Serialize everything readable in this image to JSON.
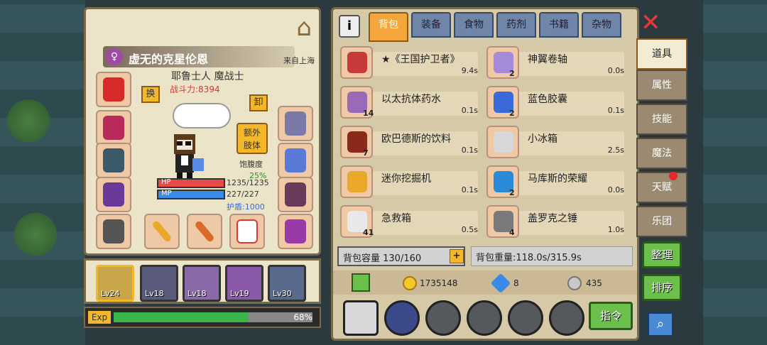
{
  "character": {
    "name": "虚无的克星伦恩",
    "origin": "来自上海",
    "class": "耶鲁士人 魔战士",
    "power": "战斗力:8394",
    "swap_label": "换",
    "unequip_label": "卸",
    "extra_limb_label": "额外\n肢体",
    "hunger_label": "饱腹度",
    "hunger_value": "25%",
    "hp_label": "HP",
    "hp_value": "1235/1235",
    "mp_label": "MP",
    "mp_value": "227/227",
    "shield_label": "护盾:1000"
  },
  "party": [
    {
      "level": "Lv24",
      "active": true
    },
    {
      "level": "Lv18",
      "active": false
    },
    {
      "level": "Lv18",
      "active": false
    },
    {
      "level": "Lv19",
      "active": false
    },
    {
      "level": "Lv30",
      "active": false
    }
  ],
  "exp": {
    "label": "Exp",
    "value": "68%",
    "progress": 0.68
  },
  "tabs": [
    "背包",
    "装备",
    "食物",
    "药剂",
    "书籍",
    "杂物"
  ],
  "active_tab": "背包",
  "items": [
    {
      "name": "★《王国护卫者》",
      "weight": "9.4s",
      "count": "",
      "color": "#c83a3a"
    },
    {
      "name": "神翼卷轴",
      "weight": "0.0s",
      "count": "2",
      "color": "#a48ad8"
    },
    {
      "name": "以太抗体药水",
      "weight": "0.1s",
      "count": "14",
      "color": "#9a6ab8"
    },
    {
      "name": "蓝色胶囊",
      "weight": "0.1s",
      "count": "2",
      "color": "#3a6ad8"
    },
    {
      "name": "欧巴德斯的饮料",
      "weight": "0.1s",
      "count": "7",
      "color": "#8a2a1a"
    },
    {
      "name": "小冰箱",
      "weight": "2.5s",
      "count": "",
      "color": "#d8d8d8"
    },
    {
      "name": "迷你挖掘机",
      "weight": "0.1s",
      "count": "",
      "color": "#e8a82a"
    },
    {
      "name": "马库斯的荣耀",
      "weight": "0.0s",
      "count": "2",
      "color": "#2a8ad8"
    },
    {
      "name": "急救箱",
      "weight": "0.5s",
      "count": "41",
      "color": "#e8e8e8"
    },
    {
      "name": "盖罗克之锤",
      "weight": "1.0s",
      "count": "4",
      "color": "#7a7a7a"
    }
  ],
  "capacity": "背包容量 130/160",
  "capacity_plus": "+",
  "weight": "背包重量:118.0s/315.9s",
  "gold": "1735148",
  "diamonds": "8",
  "silver": "435",
  "command_label": "指令",
  "side_tabs": [
    "道具",
    "属性",
    "技能",
    "魔法",
    "天赋",
    "乐团"
  ],
  "active_side_tab": "道具",
  "sort_buttons": [
    "整理",
    "排序"
  ],
  "info_label": "i",
  "colors": {
    "accent": "#f4a63a",
    "green": "#6ac04a",
    "hp": "#e84a4a",
    "mp": "#3a8ae8"
  }
}
